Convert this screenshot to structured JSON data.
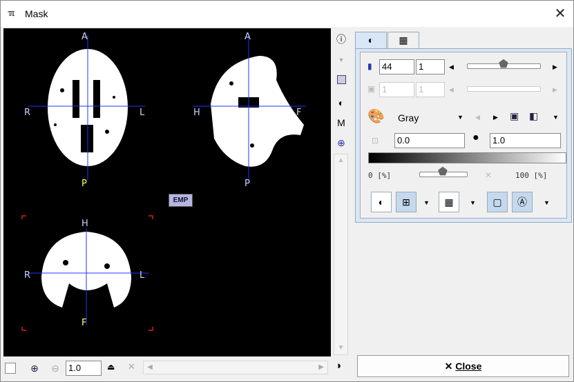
{
  "window": {
    "title": "Mask",
    "app_icon": "pmod-logo",
    "close_glyph": "✕"
  },
  "viewer": {
    "labels": {
      "axial": {
        "top": "A",
        "left": "R",
        "right": "L",
        "bottom": "P"
      },
      "sagittal": {
        "top": "A",
        "left": "H",
        "right": "F",
        "bottom": "P"
      },
      "coronal": {
        "top": "H",
        "left": "R",
        "right": "L",
        "bottom": "F"
      }
    },
    "badge": "EMP"
  },
  "bottom": {
    "zoom_value": "1.0"
  },
  "tabs": [
    {
      "icon": "contrast-icon"
    },
    {
      "icon": "layout-icon"
    }
  ],
  "panel": {
    "slice_value": "44",
    "slice_step": "1",
    "frame_value": "1",
    "frame_step": "1",
    "colormap": "Gray",
    "lower_value": "0.0",
    "upper_value": "1.0",
    "range_min": "0 [%]",
    "range_max": "100 [%]"
  },
  "close_button": {
    "icon": "✕",
    "label": "Close"
  },
  "colors": {
    "accent": "#d9e7f6",
    "crosshair": "#2233ff",
    "mark_red": "#cc2222"
  }
}
